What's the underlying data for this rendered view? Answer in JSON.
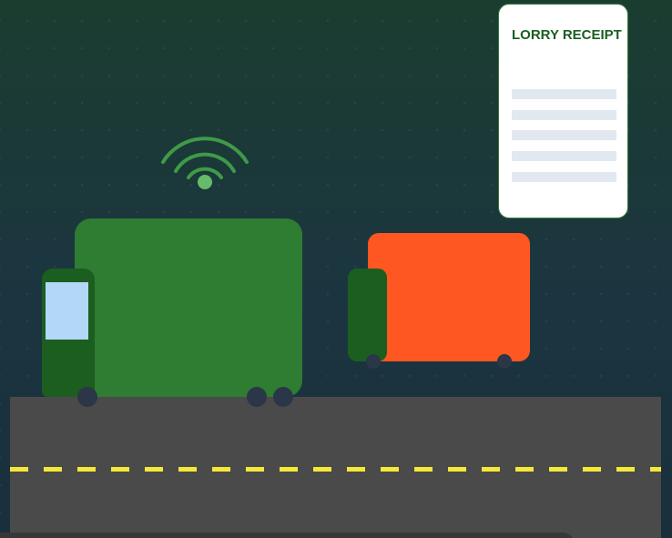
{
  "scene": {
    "background_colors": [
      "#1b3d30",
      "#1a2f3c"
    ],
    "road_color": "#4a4a4a",
    "lane_marking_color": "#f4e83a"
  },
  "receipt": {
    "title": "LORRY RECEIPT",
    "title_color": "#1b5e20",
    "placeholder_line_count": 5
  },
  "vehicles": [
    {
      "name": "main-truck",
      "body_color": "#2e7d32",
      "cab_color": "#1b5e20",
      "window_color": "#b3d7f7"
    },
    {
      "name": "orange-truck",
      "body_color": "#ff5722",
      "cab_color": "#1b5e20"
    }
  ],
  "icons": {
    "signal": "wifi-signal-icon",
    "signal_color": "#5cb860"
  }
}
